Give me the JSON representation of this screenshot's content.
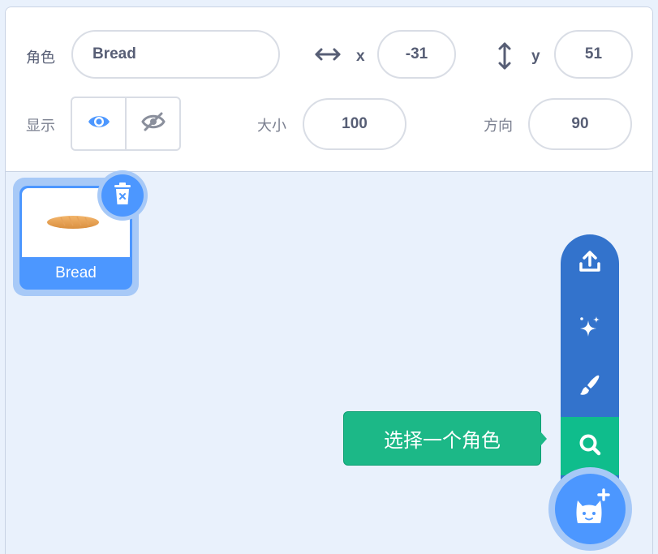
{
  "sprite_info": {
    "sprite_label": "角色",
    "sprite_name": "Bread",
    "x_label": "x",
    "x_value": "-31",
    "y_label": "y",
    "y_value": "51",
    "show_label": "显示",
    "size_label": "大小",
    "size_value": "100",
    "direction_label": "方向",
    "direction_value": "90"
  },
  "sprite_list": [
    {
      "name": "Bread",
      "selected": true
    }
  ],
  "sprite_menu": {
    "tooltip": "选择一个角色",
    "items": [
      "upload-icon",
      "surprise-icon",
      "paint-icon",
      "search-icon"
    ],
    "active_item": "search-icon",
    "main_icon": "cat-plus-icon"
  },
  "colors": {
    "accent": "#4c97ff",
    "menu": "#3373cc",
    "active": "#0fbd8c",
    "text": "#575e75"
  }
}
